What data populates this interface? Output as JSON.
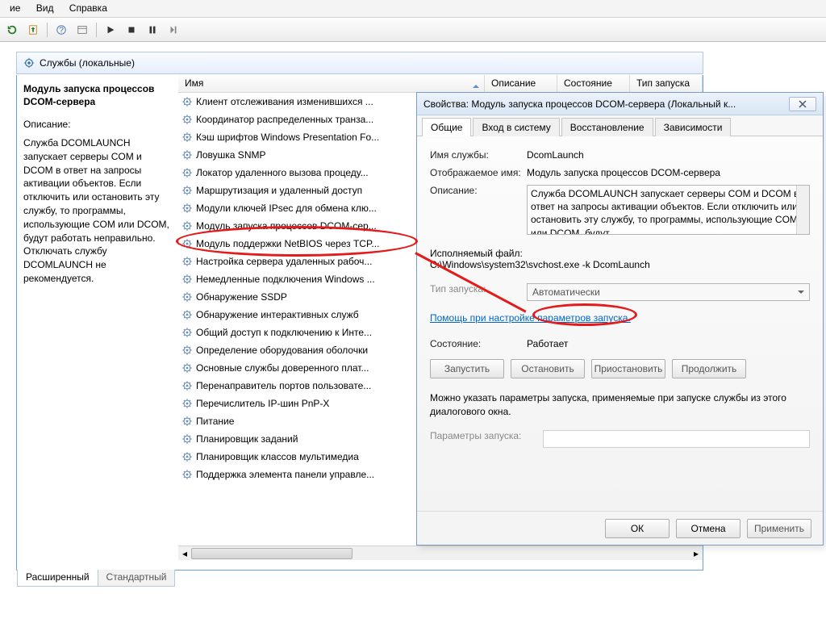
{
  "menu": {
    "items": [
      "ие",
      "Вид",
      "Справка"
    ]
  },
  "panel_header": "Службы (локальные)",
  "desc": {
    "title": "Модуль запуска процессов DCOM-сервера",
    "label": "Описание:",
    "text": "Служба DCOMLAUNCH запускает серверы COM и DCOM в ответ на запросы активации объектов. Если отключить или остановить эту службу, то программы, использующие COM или DCOM, будут работать неправильно. Отключать службу DCOMLAUNCH не рекомендуется."
  },
  "columns": [
    "Имя",
    "Описание",
    "Состояние",
    "Тип запуска"
  ],
  "services": [
    "Клиент отслеживания изменившихся ...",
    "Координатор распределенных транза...",
    "Кэш шрифтов Windows Presentation Fo...",
    "Ловушка SNMP",
    "Локатор удаленного вызова процеду...",
    "Маршрутизация и удаленный доступ",
    "Модули ключей IPsec для обмена клю...",
    "Модуль запуска процессов DCOM-сер...",
    "Модуль поддержки NetBIOS через TCP...",
    "Настройка сервера удаленных рабоч...",
    "Немедленные подключения Windows ...",
    "Обнаружение SSDP",
    "Обнаружение интерактивных служб",
    "Общий доступ к подключению к Инте...",
    "Определение оборудования оболочки",
    "Основные службы доверенного плат...",
    "Перенаправитель портов пользовате...",
    "Перечислитель IP-шин PnP-X",
    "Питание",
    "Планировщик заданий",
    "Планировщик классов мультимедиа",
    "Поддержка элемента панели управле..."
  ],
  "selected_index": 7,
  "bottom_tabs": {
    "extended": "Расширенный",
    "standard": "Стандартный"
  },
  "dialog": {
    "title": "Свойства: Модуль запуска процессов DCOM-сервера (Локальный к...",
    "tabs": [
      "Общие",
      "Вход в систему",
      "Восстановление",
      "Зависимости"
    ],
    "service_name_lbl": "Имя службы:",
    "service_name": "DcomLaunch",
    "display_name_lbl": "Отображаемое имя:",
    "display_name": "Модуль запуска процессов DCOM-сервера",
    "description_lbl": "Описание:",
    "description": "Служба DCOMLAUNCH запускает серверы COM и DCOM в ответ на запросы активации объектов. Если отключить или остановить эту службу, то программы, использующие COM или DCOM, будут",
    "path_lbl": "Исполняемый файл:",
    "path": "C:\\Windows\\system32\\svchost.exe -k DcomLaunch",
    "startup_lbl": "Тип запуска:",
    "startup_value": "Автоматически",
    "help_link": "Помощь при настройке параметров запуска.",
    "status_lbl": "Состояние:",
    "status": "Работает",
    "btn_start": "Запустить",
    "btn_stop": "Остановить",
    "btn_pause": "Приостановить",
    "btn_resume": "Продолжить",
    "params_hint": "Можно указать параметры запуска, применяемые при запуске службы из этого диалогового окна.",
    "params_lbl": "Параметры запуска:",
    "ok": "ОК",
    "cancel": "Отмена",
    "apply": "Применить"
  }
}
